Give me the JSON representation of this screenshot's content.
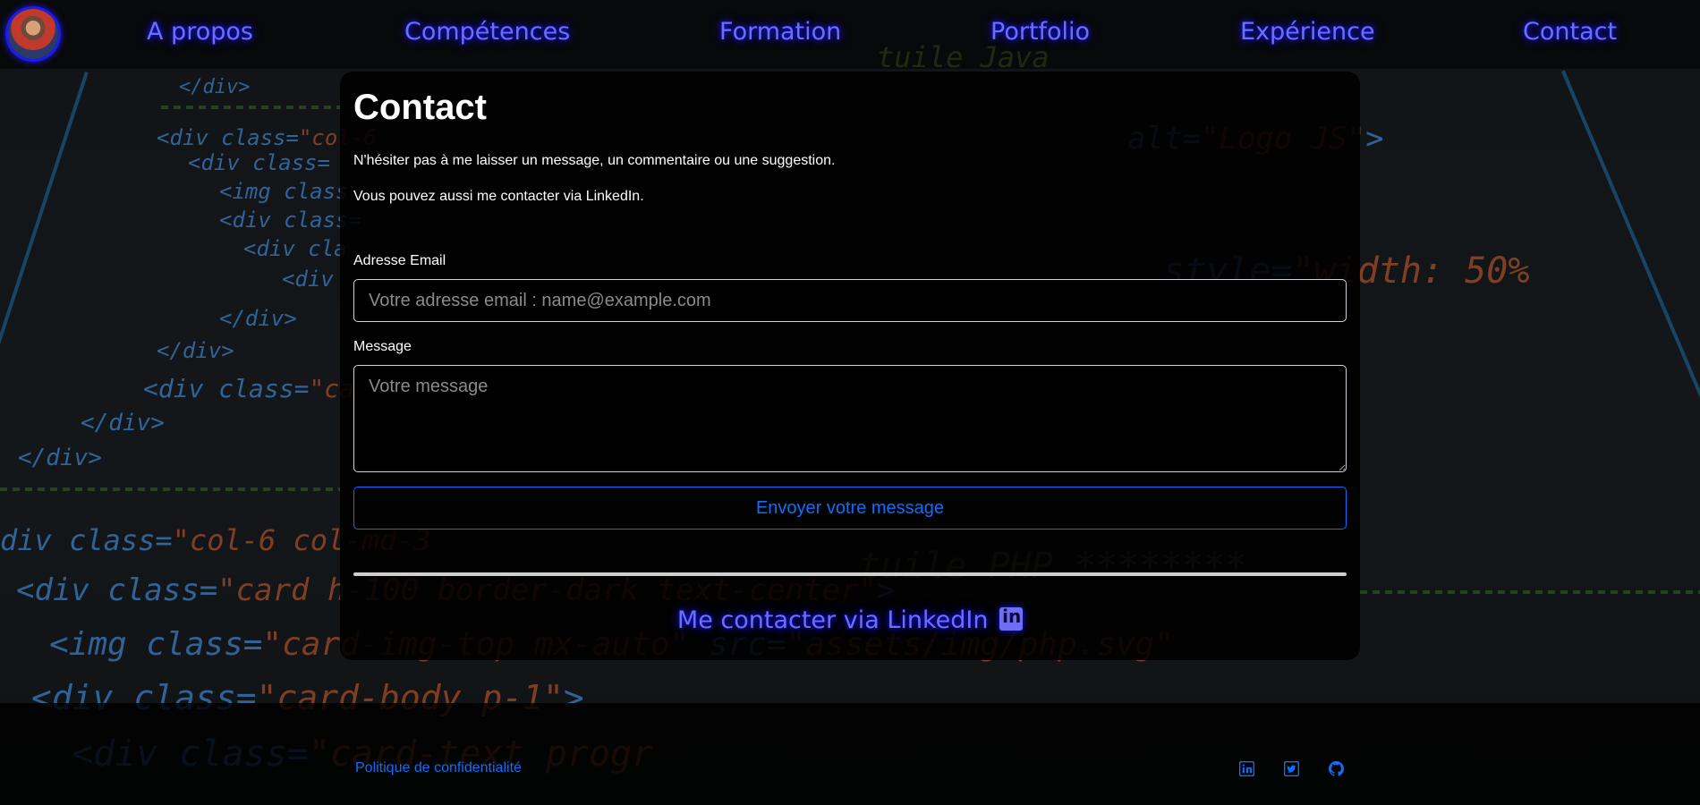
{
  "nav": {
    "items": [
      {
        "label": "A propos"
      },
      {
        "label": "Compétences"
      },
      {
        "label": "Formation"
      },
      {
        "label": "Portfolio"
      },
      {
        "label": "Expérience"
      },
      {
        "label": "Contact"
      }
    ]
  },
  "contact": {
    "title": "Contact",
    "intro": "N'hésiter pas à me laisser un message, un commentaire ou une suggestion.",
    "linkedin_note": "Vous pouvez aussi me contacter via LinkedIn.",
    "email_label": "Adresse Email",
    "email_placeholder": "Votre adresse email : name@example.com",
    "message_label": "Message",
    "message_placeholder": "Votre message",
    "submit_label": "Envoyer votre message",
    "linkedin_cta": "Me contacter via LinkedIn"
  },
  "footer": {
    "privacy_label": "Politique de confidentialité",
    "social": [
      "linkedin-icon",
      "twitter-icon",
      "github-icon"
    ]
  },
  "colors": {
    "nav_glow": "#6e6ef5",
    "link_blue": "#0d6efd"
  }
}
